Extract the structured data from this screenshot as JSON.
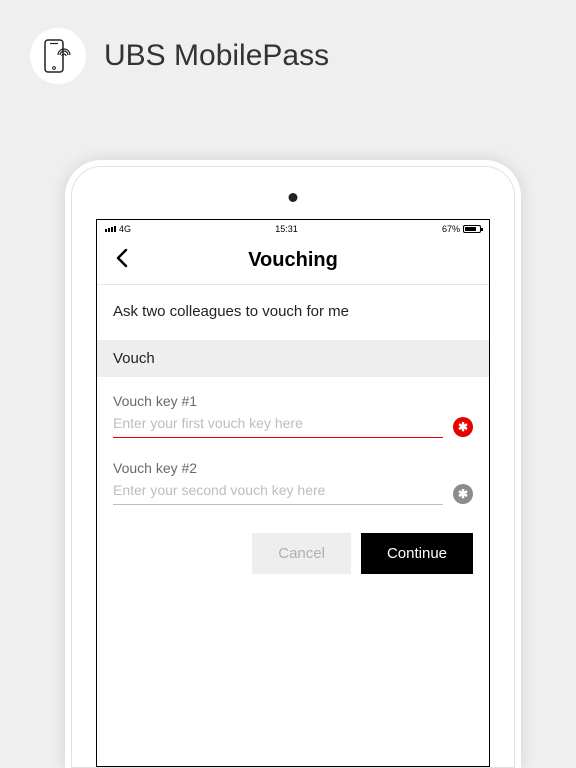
{
  "app": {
    "name": "UBS MobilePass",
    "icon": "fingerprint-phone-icon"
  },
  "status_bar": {
    "network": "4G",
    "time": "15:31",
    "battery_percent": "67%"
  },
  "screen": {
    "title": "Vouching",
    "subtitle": "Ask two colleagues to vouch for me",
    "section_label": "Vouch",
    "fields": [
      {
        "label": "Vouch key #1",
        "placeholder": "Enter your first vouch key here",
        "required_state": "error"
      },
      {
        "label": "Vouch key #2",
        "placeholder": "Enter your second vouch key here",
        "required_state": "normal"
      }
    ],
    "buttons": {
      "cancel": "Cancel",
      "continue": "Continue"
    }
  }
}
